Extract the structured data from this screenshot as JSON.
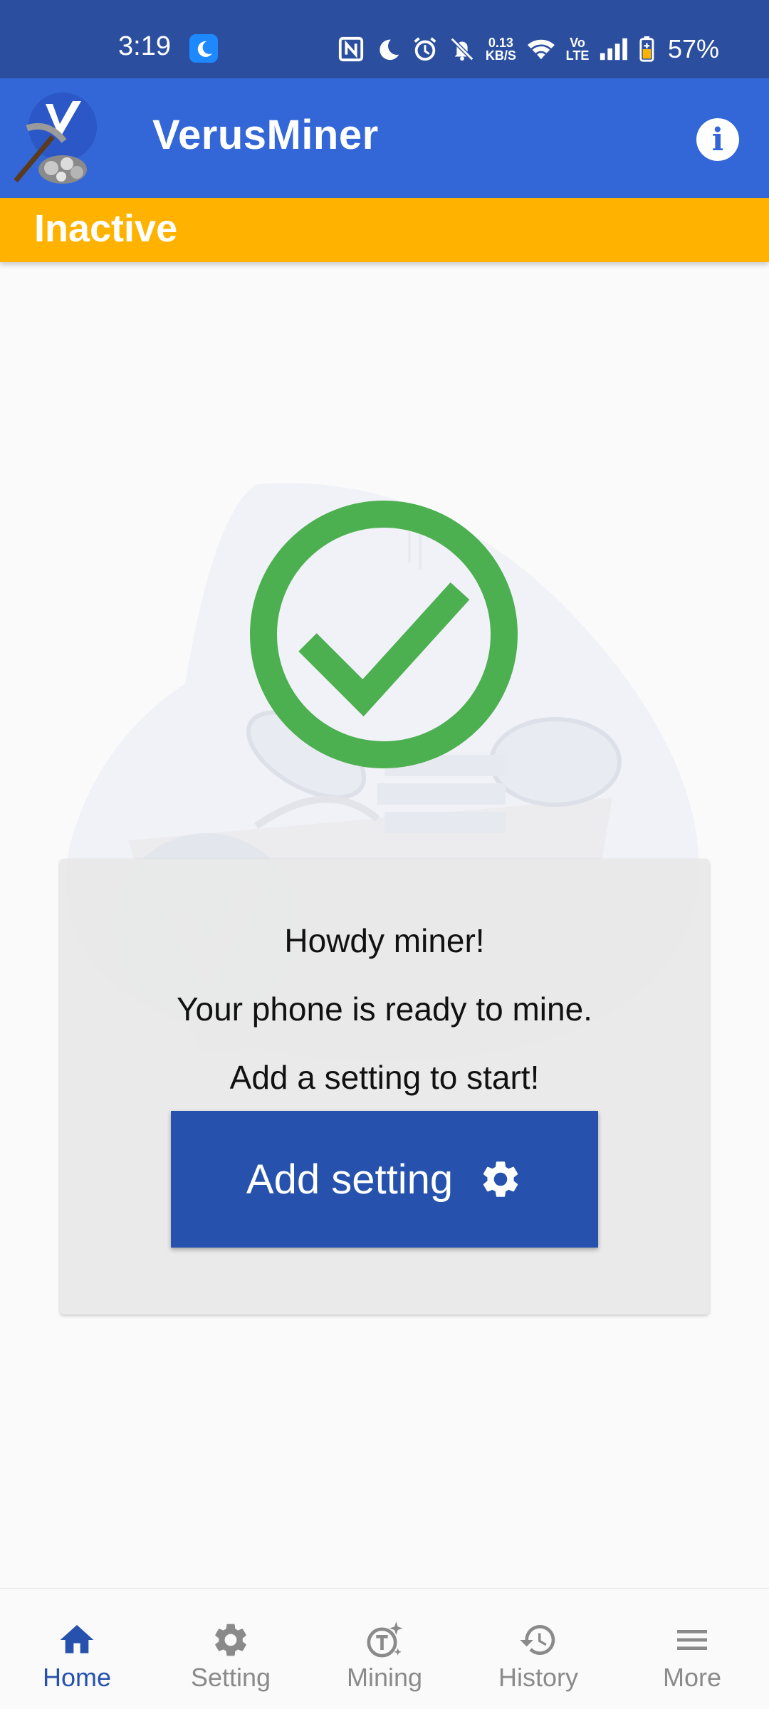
{
  "status_bar": {
    "time": "3:19",
    "speed_top": "0.13",
    "speed_bottom": "KB/S",
    "network_top": "Vo",
    "network_bottom": "LTE",
    "battery": "57%"
  },
  "app_bar": {
    "title": "VerusMiner",
    "info_glyph": "i"
  },
  "status": {
    "label": "Inactive",
    "color": "#ffb300"
  },
  "card": {
    "greeting": "Howdy miner!",
    "ready_text": "Your phone is ready to mine.",
    "instruction": "Add a setting to start!",
    "button_label": "Add setting"
  },
  "nav": {
    "items": [
      {
        "label": "Home",
        "icon": "home-icon",
        "active": true
      },
      {
        "label": "Setting",
        "icon": "gear-icon"
      },
      {
        "label": "Mining",
        "icon": "mining-icon"
      },
      {
        "label": "History",
        "icon": "history-icon"
      },
      {
        "label": "More",
        "icon": "menu-icon"
      }
    ]
  },
  "colors": {
    "status_bar": "#2b4f9e",
    "app_bar": "#3366d6",
    "accent": "#2652ad",
    "check": "#4caf50"
  }
}
